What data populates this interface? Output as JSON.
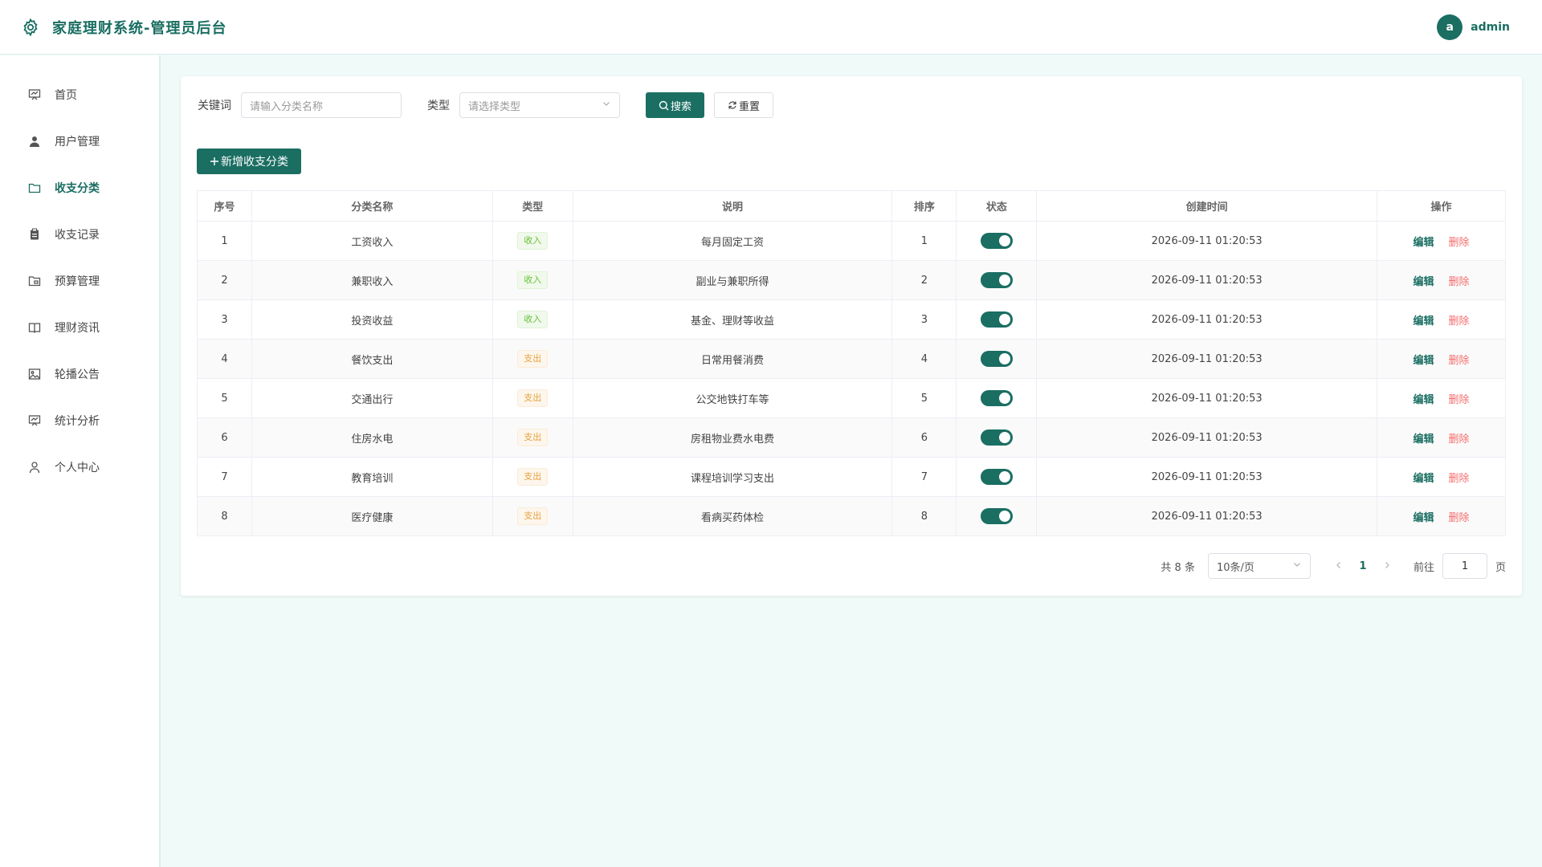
{
  "app": {
    "title": "家庭理财系统-管理员后台"
  },
  "user": {
    "avatar_letter": "a",
    "name": "admin"
  },
  "sidebar": {
    "items": [
      {
        "label": "首页",
        "icon": "chart-board-icon",
        "active": false
      },
      {
        "label": "用户管理",
        "icon": "user-icon",
        "active": false
      },
      {
        "label": "收支分类",
        "icon": "folder-icon",
        "active": true
      },
      {
        "label": "收支记录",
        "icon": "clipboard-icon",
        "active": false
      },
      {
        "label": "预算管理",
        "icon": "folder-open-icon",
        "active": false
      },
      {
        "label": "理财资讯",
        "icon": "book-icon",
        "active": false
      },
      {
        "label": "轮播公告",
        "icon": "picture-icon",
        "active": false
      },
      {
        "label": "统计分析",
        "icon": "chart-board-icon",
        "active": false
      },
      {
        "label": "个人中心",
        "icon": "person-outline-icon",
        "active": false
      }
    ]
  },
  "filters": {
    "keyword_label": "关键词",
    "keyword_placeholder": "请输入分类名称",
    "type_label": "类型",
    "type_placeholder": "请选择类型",
    "search_label": "搜索",
    "reset_label": "重置"
  },
  "add_button": "新增收支分类",
  "table": {
    "columns": [
      "序号",
      "分类名称",
      "类型",
      "说明",
      "排序",
      "状态",
      "创建时间",
      "操作"
    ],
    "edit_label": "编辑",
    "delete_label": "删除",
    "rows": [
      {
        "index": "1",
        "name": "工资收入",
        "type": "收入",
        "desc": "每月固定工资",
        "sort": "1",
        "enabled": true,
        "created": "2026-09-11 01:20:53"
      },
      {
        "index": "2",
        "name": "兼职收入",
        "type": "收入",
        "desc": "副业与兼职所得",
        "sort": "2",
        "enabled": true,
        "created": "2026-09-11 01:20:53"
      },
      {
        "index": "3",
        "name": "投资收益",
        "type": "收入",
        "desc": "基金、理财等收益",
        "sort": "3",
        "enabled": true,
        "created": "2026-09-11 01:20:53"
      },
      {
        "index": "4",
        "name": "餐饮支出",
        "type": "支出",
        "desc": "日常用餐消费",
        "sort": "4",
        "enabled": true,
        "created": "2026-09-11 01:20:53"
      },
      {
        "index": "5",
        "name": "交通出行",
        "type": "支出",
        "desc": "公交地铁打车等",
        "sort": "5",
        "enabled": true,
        "created": "2026-09-11 01:20:53"
      },
      {
        "index": "6",
        "name": "住房水电",
        "type": "支出",
        "desc": "房租物业费水电费",
        "sort": "6",
        "enabled": true,
        "created": "2026-09-11 01:20:53"
      },
      {
        "index": "7",
        "name": "教育培训",
        "type": "支出",
        "desc": "课程培训学习支出",
        "sort": "7",
        "enabled": true,
        "created": "2026-09-11 01:20:53"
      },
      {
        "index": "8",
        "name": "医疗健康",
        "type": "支出",
        "desc": "看病买药体检",
        "sort": "8",
        "enabled": true,
        "created": "2026-09-11 01:20:53"
      }
    ]
  },
  "pagination": {
    "total_text": "共 8 条",
    "page_size": "10条/页",
    "current_page": "1",
    "goto_label": "前往",
    "goto_value": "1",
    "page_unit": "页"
  },
  "colors": {
    "primary": "#1a6e62",
    "danger": "#f56c6c",
    "income": "#67c23a",
    "expense": "#e6a23c"
  }
}
